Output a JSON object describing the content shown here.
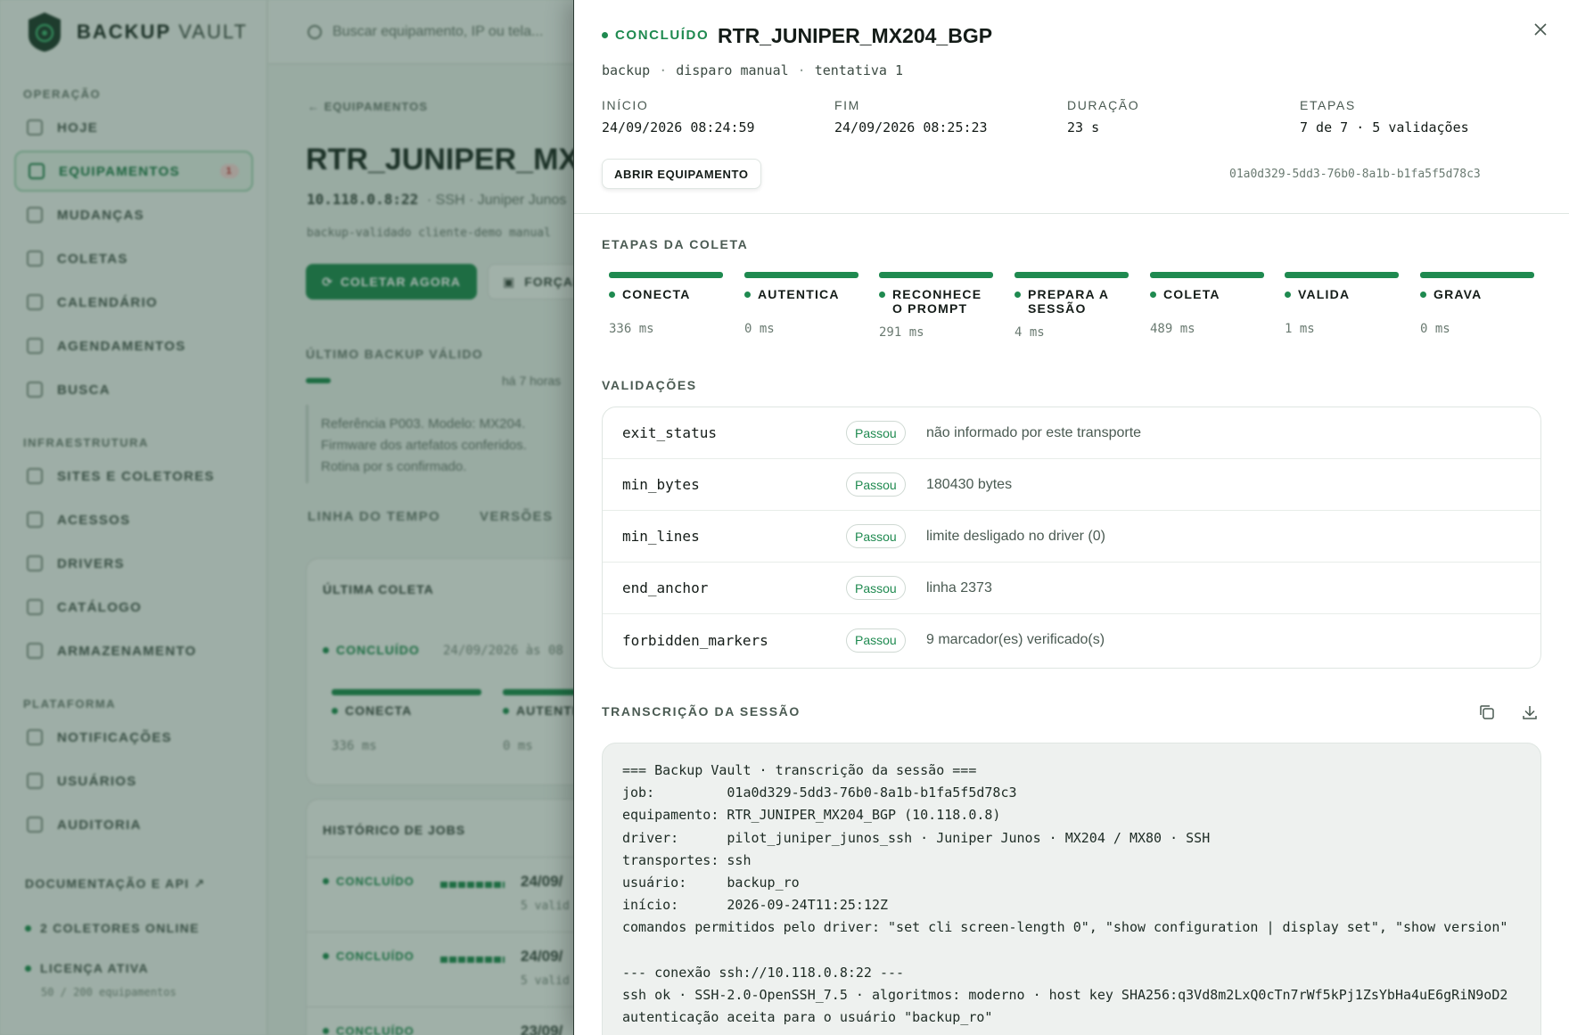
{
  "brand": {
    "name_bold": "BACKUP",
    "name_light": "VAULT"
  },
  "search": {
    "placeholder": "Buscar equipamento, IP ou tela..."
  },
  "sidebar": {
    "sections": [
      "OPERAÇÃO",
      "INFRAESTRUTURA",
      "PLATAFORMA"
    ],
    "items": [
      {
        "label": "HOJE"
      },
      {
        "label": "EQUIPAMENTOS",
        "badge": "1",
        "active": true
      },
      {
        "label": "MUDANÇAS"
      },
      {
        "label": "COLETAS"
      },
      {
        "label": "CALENDÁRIO"
      },
      {
        "label": "AGENDAMENTOS"
      },
      {
        "label": "BUSCA"
      },
      {
        "label": "SITES E COLETORES"
      },
      {
        "label": "ACESSOS"
      },
      {
        "label": "DRIVERS"
      },
      {
        "label": "CATÁLOGO"
      },
      {
        "label": "ARMAZENAMENTO"
      },
      {
        "label": "NOTIFICAÇÕES"
      },
      {
        "label": "USUÁRIOS"
      },
      {
        "label": "AUDITORIA"
      }
    ],
    "docs_link": "DOCUMENTAÇÃO E API ↗",
    "collectors_online": "2 COLETORES ONLINE",
    "license": "LICENÇA ATIVA",
    "license_usage": "50 / 200 equipamentos"
  },
  "background_page": {
    "breadcrumb": "EQUIPAMENTOS",
    "title": "RTR_JUNIPER_MX204_BGP",
    "address": "10.118.0.8:22",
    "address_suffix": "· SSH · Juniper Junos",
    "tags": "backup-validado cliente-demo manual",
    "collect_button": "COLETAR AGORA",
    "force_button": "FORÇAR",
    "last_backup_label": "ÚLTIMO BACKUP VÁLIDO",
    "last_backup_ago": "há 7 horas",
    "reference_text": "Referência P003. Modelo: MX204. Firmware dos artefatos conferidos. Rotina por s confirmado.",
    "tabs": [
      "LINHA DO TEMPO",
      "VERSÕES"
    ],
    "last_collect_title": "ÚLTIMA COLETA",
    "last_collect_status": "CONCLUÍDO",
    "last_collect_date": "24/09/2026 às 08",
    "last_collect_steps": [
      {
        "name": "CONECTA",
        "ms": "336 ms"
      },
      {
        "name": "AUTENTICA",
        "ms": "0 ms"
      }
    ],
    "history_title": "HISTÓRICO DE JOBS",
    "history_rows": [
      {
        "status": "CONCLUÍDO",
        "date": "24/09/",
        "sub": "5 valid"
      },
      {
        "status": "CONCLUÍDO",
        "date": "24/09/",
        "sub": "5 valid"
      },
      {
        "status": "CONCLUÍDO",
        "date": "23/09/",
        "sub": ""
      }
    ]
  },
  "drawer": {
    "status": "CONCLUÍDO",
    "title": "RTR_JUNIPER_MX204_BGP",
    "meta": [
      "backup",
      "disparo manual",
      "tentativa 1"
    ],
    "stats": [
      {
        "key": "INÍCIO",
        "value": "24/09/2026 08:24:59"
      },
      {
        "key": "FIM",
        "value": "24/09/2026 08:25:23"
      },
      {
        "key": "DURAÇÃO",
        "value": "23 s"
      },
      {
        "key": "ETAPAS",
        "value": "7 de 7 · 5 validações"
      }
    ],
    "open_button": "ABRIR EQUIPAMENTO",
    "job_id": "01a0d329-5dd3-76b0-8a1b-b1fa5f5d78c3",
    "steps_label": "ETAPAS DA COLETA",
    "steps": [
      {
        "name": "CONECTA",
        "ms": "336 ms"
      },
      {
        "name": "AUTENTICA",
        "ms": "0 ms"
      },
      {
        "name": "RECONHECE O PROMPT",
        "ms": "291 ms"
      },
      {
        "name": "PREPARA A SESSÃO",
        "ms": "4 ms"
      },
      {
        "name": "COLETA",
        "ms": "489 ms"
      },
      {
        "name": "VALIDA",
        "ms": "1 ms"
      },
      {
        "name": "GRAVA",
        "ms": "0 ms"
      }
    ],
    "validations_label": "VALIDAÇÕES",
    "validations": [
      {
        "key": "exit_status",
        "result": "Passou",
        "detail": "não informado por este transporte"
      },
      {
        "key": "min_bytes",
        "result": "Passou",
        "detail": "180430 bytes"
      },
      {
        "key": "min_lines",
        "result": "Passou",
        "detail": "limite desligado no driver (0)"
      },
      {
        "key": "end_anchor",
        "result": "Passou",
        "detail": "linha 2373"
      },
      {
        "key": "forbidden_markers",
        "result": "Passou",
        "detail": "9 marcador(es) verificado(s)"
      }
    ],
    "transcript_label": "TRANSCRIÇÃO DA SESSÃO",
    "transcript_lines": [
      "=== Backup Vault · transcrição da sessão ===",
      "job:         01a0d329-5dd3-76b0-8a1b-b1fa5f5d78c3",
      "equipamento: RTR_JUNIPER_MX204_BGP (10.118.0.8)",
      "driver:      pilot_juniper_junos_ssh · Juniper Junos · MX204 / MX80 · SSH",
      "transportes: ssh",
      "usuário:     backup_ro",
      "início:      2026-09-24T11:25:12Z",
      "comandos permitidos pelo driver: \"set cli screen-length 0\", \"show configuration | display set\", \"show version\"",
      "",
      "--- conexão ssh://10.118.0.8:22 ---",
      "ssh ok · SSH-2.0-OpenSSH_7.5 · algoritmos: moderno · host key SHA256:q3Vd8m2LxQ0cTn7rWf5kPj1ZsYbHa4uE6gRiN9oD2",
      "autenticação aceita para o usuário \"backup_ro\""
    ],
    "icons": {
      "close": "close-icon",
      "copy": "copy-icon",
      "download": "download-icon"
    }
  },
  "colors": {
    "accent": "#1f8a50",
    "text": "#141c18",
    "muted": "#6a7a71"
  }
}
